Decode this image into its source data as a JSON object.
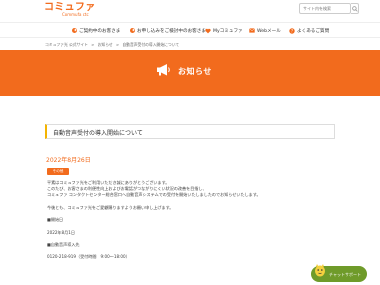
{
  "header": {
    "logo_main": "コミュファ",
    "logo_sub": "Commufa ctc",
    "search_placeholder": "サイト内を検索"
  },
  "nav": {
    "items": [
      {
        "label": "ご契約中のお客さま"
      },
      {
        "label": "お申し込みをご検討中のお客さま"
      },
      {
        "label": "Myコミュファ"
      },
      {
        "label": "Webメール"
      },
      {
        "label": "よくあるご質問"
      }
    ]
  },
  "breadcrumb": [
    "コミュファ光 公式サイト",
    ">",
    "お知らせ",
    ">",
    "自動音声受付の導入開始について"
  ],
  "banner": {
    "title": "お知らせ",
    "icon": "megaphone-icon"
  },
  "article": {
    "headline": "自動音声受付の導入開始について",
    "date": "2022年8月26日",
    "tag": "その他",
    "lines": [
      "平素はコミュファ光をご利用いただき誠にありがとうございます。",
      "このたび、お客さまの利便性向上およびお電話がつながりにくい状況の改善を目指し、",
      "コミュファ コンタクトセンター総合窓口へ自動音声システムでの受付を開始いたしましたのでお知らせいたします。",
      "",
      "今後とも、コミュファ光をご愛顧賜りますようお願い申し上げます。",
      "",
      "■開始日",
      "",
      "2022年8月1日",
      "",
      "■自動音声導入先",
      "",
      "0120-218-919（受付時間　9:00～18:00）"
    ]
  },
  "chat": {
    "label": "チャットサポート",
    "color": "#6f9b2a"
  },
  "colors": {
    "brand": "#f26b1d",
    "accent": "#f4b400"
  }
}
